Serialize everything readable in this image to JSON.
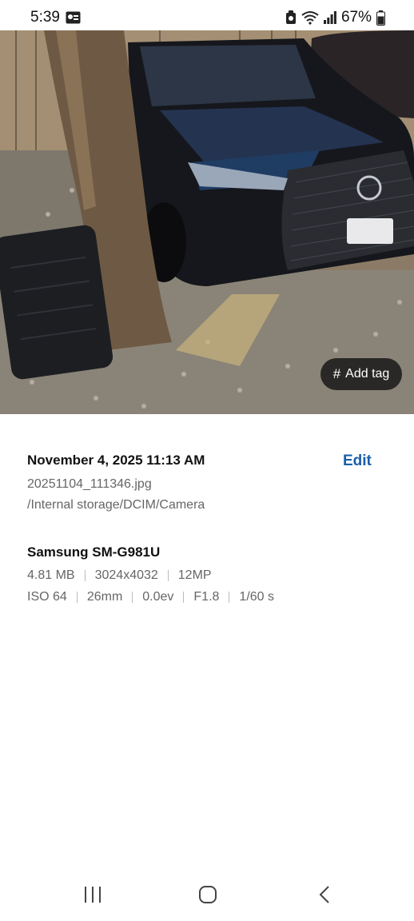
{
  "status_bar": {
    "time": "5:39",
    "battery_percent": "67%",
    "icons": [
      "notification-app-icon",
      "alarm-icon",
      "wifi-icon",
      "signal-icon",
      "battery-icon"
    ]
  },
  "photo": {
    "description_icon": "photo-preview",
    "add_tag": {
      "hash": "#",
      "label": "Add tag"
    }
  },
  "details": {
    "datetime": "November 4, 2025 11:13 AM",
    "edit_label": "Edit",
    "filename": "20251104_111346.jpg",
    "path": "/Internal storage/DCIM/Camera",
    "device": "Samsung SM-G981U",
    "specs_row1": [
      "4.81 MB",
      "3024x4032",
      "12MP"
    ],
    "specs_row2": [
      "ISO 64",
      "26mm",
      "0.0ev",
      "F1.8",
      "1/60 s"
    ]
  },
  "nav": {
    "recents": "recents-icon",
    "home": "home-icon",
    "back": "back-icon"
  },
  "colors": {
    "edit_accent": "#1a5fa8",
    "tag_bg": "#141414"
  }
}
